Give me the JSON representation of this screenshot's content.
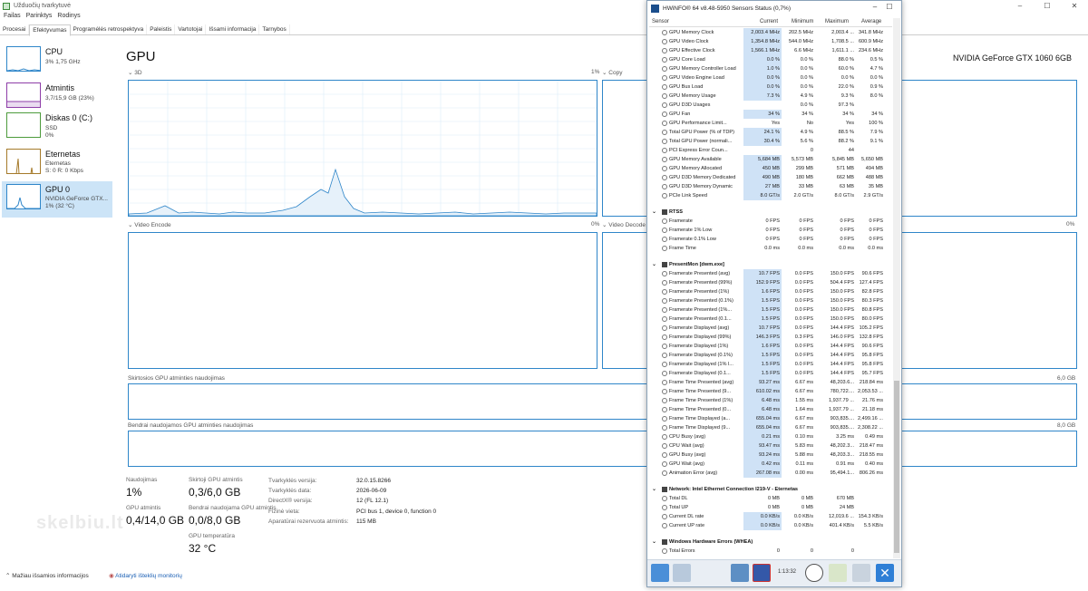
{
  "taskmanager": {
    "title": "Užduočių tvarkytuvė",
    "menu": [
      "Failas",
      "Parinktys",
      "Rodinys"
    ],
    "tabs": [
      "Procesai",
      "Efektyvumas",
      "Programėlės retrospektyva",
      "Paleistis",
      "Vartotojai",
      "Išsami informacija",
      "Tarnybos"
    ],
    "active_tab": 1,
    "sidebar": [
      {
        "name": "CPU",
        "sub1": "3%  1,75 GHz",
        "sub2": "",
        "sub3": ""
      },
      {
        "name": "Atmintis",
        "sub1": "3,7/15,9 GB (23%)",
        "sub2": "",
        "sub3": ""
      },
      {
        "name": "Diskas 0 (C:)",
        "sub1": "SSD",
        "sub2": "0%",
        "sub3": ""
      },
      {
        "name": "Eternetas",
        "sub1": "Eternetas",
        "sub2": "S: 0 R: 0 Kbps",
        "sub3": ""
      },
      {
        "name": "GPU 0",
        "sub1": "NVIDIA GeForce GTX...",
        "sub2": "1% (32 °C)",
        "sub3": ""
      }
    ],
    "heading": "GPU",
    "gpu_name": "NVIDIA GeForce GTX 1060 6GB",
    "graphs": {
      "g3d": "3D",
      "g3d_pct": "1%",
      "copy": "Copy",
      "venc": "Video Encode",
      "venc_pct": "0%",
      "vdec": "Video Decode",
      "vdec_pct": "0%",
      "dedicated": "Skirtosios GPU atminties naudojimas",
      "dedicated_max": "6,0 GB",
      "shared": "Bendrai naudojamos GPU atminties naudojimas",
      "shared_max": "8,0 GB"
    },
    "stats": {
      "usage_label": "Naudojimas",
      "usage_value": "1%",
      "dedicated_label": "Skirtoji GPU atmintis",
      "dedicated_value": "0,3/6,0 GB",
      "gpumem_label": "GPU atmintis",
      "gpumem_value": "0,4/14,0 GB",
      "shared_label": "Bendrai naudojama GPU atmintis",
      "shared_value": "0,0/8,0 GB",
      "temp_label": "GPU temperatūra",
      "temp_value": "32 °C"
    },
    "info": [
      {
        "label": "Tvarkyklės versija:",
        "value": "32.0.15.8266"
      },
      {
        "label": "Tvarkyklės data:",
        "value": "2026-06-09"
      },
      {
        "label": "DirectX® versija:",
        "value": "12 (FL 12.1)"
      },
      {
        "label": "Fizinė vieta:",
        "value": "PCI bus 1, device 0, function 0"
      },
      {
        "label": "Aparatūrai rezervuota atmintis:",
        "value": "115 MB"
      }
    ],
    "footer": {
      "fewer": "Mažiau išsamios informacijos",
      "monitor": "Atidaryti išteklių monitorių"
    },
    "watermark": "skelbiu.lt"
  },
  "hwinfo": {
    "title": "HWiNFO® 64 v8.48-5950 Sensors Status (0,7%)",
    "columns": [
      "Sensor",
      "Current",
      "Minimum",
      "Maximum",
      "Average"
    ],
    "rows": [
      {
        "type": "row",
        "name": "GPU Memory Clock",
        "v": [
          "2,003.4 MHz",
          "202.5 MHz",
          "2,003.4 ...",
          "341.8 MHz"
        ],
        "hl": true
      },
      {
        "type": "row",
        "name": "GPU Video Clock",
        "v": [
          "1,354.8 MHz",
          "544.0 MHz",
          "1,708.5 ...",
          "600.9 MHz"
        ],
        "hl": true
      },
      {
        "type": "row",
        "name": "GPU Effective Clock",
        "v": [
          "1,566.1 MHz",
          "6.6 MHz",
          "1,611.1 ...",
          "234.6 MHz"
        ],
        "hl": true
      },
      {
        "type": "row",
        "name": "GPU Core Load",
        "v": [
          "0.0 %",
          "0.0 %",
          "88.0 %",
          "0.5 %"
        ],
        "hl": true
      },
      {
        "type": "row",
        "name": "GPU Memory Controller Load",
        "v": [
          "1.0 %",
          "0.0 %",
          "60.0 %",
          "4.7 %"
        ],
        "hl": true
      },
      {
        "type": "row",
        "name": "GPU Video Engine Load",
        "v": [
          "0.0 %",
          "0.0 %",
          "0.0 %",
          "0.0 %"
        ],
        "hl": true
      },
      {
        "type": "row",
        "name": "GPU Bus Load",
        "v": [
          "0.0 %",
          "0.0 %",
          "22.0 %",
          "0.9 %"
        ],
        "hl": true
      },
      {
        "type": "row",
        "name": "GPU Memory Usage",
        "v": [
          "7.3 %",
          "4.9 %",
          "9.3 %",
          "8.0 %"
        ],
        "hl": true
      },
      {
        "type": "row",
        "name": "GPU D3D Usages",
        "v": [
          "",
          "0.0 %",
          "97.3 %",
          ""
        ],
        "hl": false
      },
      {
        "type": "row",
        "name": "GPU Fan",
        "v": [
          "34 %",
          "34 %",
          "34 %",
          "34 %"
        ],
        "hl": true
      },
      {
        "type": "row",
        "name": "GPU Performance Limit...",
        "v": [
          "Yes",
          "No",
          "Yes",
          "100 %"
        ],
        "hl": false
      },
      {
        "type": "row",
        "name": "Total GPU Power (% of TDP)",
        "v": [
          "24.1 %",
          "4.9 %",
          "88.5 %",
          "7.9 %"
        ],
        "hl": true
      },
      {
        "type": "row",
        "name": "Total GPU Power (normali...",
        "v": [
          "30.4 %",
          "5.6 %",
          "88.2 %",
          "9.1 %"
        ],
        "hl": true
      },
      {
        "type": "row",
        "name": "PCI Express Error Coun...",
        "v": [
          "",
          "0",
          "44",
          ""
        ],
        "hl": false
      },
      {
        "type": "row",
        "name": "GPU Memory Available",
        "v": [
          "5,684 MB",
          "5,573 MB",
          "5,845 MB",
          "5,650 MB"
        ],
        "hl": true
      },
      {
        "type": "row",
        "name": "GPU Memory Allocated",
        "v": [
          "450 MB",
          "299 MB",
          "571 MB",
          "494 MB"
        ],
        "hl": true
      },
      {
        "type": "row",
        "name": "GPU D3D Memory Dedicated",
        "v": [
          "490 MB",
          "180 MB",
          "662 MB",
          "488 MB"
        ],
        "hl": true
      },
      {
        "type": "row",
        "name": "GPU D3D Memory Dynamic",
        "v": [
          "27 MB",
          "33 MB",
          "63 MB",
          "35 MB"
        ],
        "hl": true
      },
      {
        "type": "row",
        "name": "PCIe Link Speed",
        "v": [
          "8.0 GT/s",
          "2.0 GT/s",
          "8.0 GT/s",
          "2.9 GT/s"
        ],
        "hl": true
      },
      {
        "type": "gap"
      },
      {
        "type": "group",
        "name": "RTSS"
      },
      {
        "type": "row",
        "name": "Framerate",
        "v": [
          "0 FPS",
          "0 FPS",
          "0 FPS",
          "0 FPS"
        ],
        "hl": false
      },
      {
        "type": "row",
        "name": "Framerate 1% Low",
        "v": [
          "0 FPS",
          "0 FPS",
          "0 FPS",
          "0 FPS"
        ],
        "hl": false
      },
      {
        "type": "row",
        "name": "Framerate 0.1% Low",
        "v": [
          "0 FPS",
          "0 FPS",
          "0 FPS",
          "0 FPS"
        ],
        "hl": false
      },
      {
        "type": "row",
        "name": "Frame Time",
        "v": [
          "0.0 ms",
          "0.0 ms",
          "0.0 ms",
          "0.0 ms"
        ],
        "hl": false
      },
      {
        "type": "gap"
      },
      {
        "type": "group",
        "name": "PresentMon [dwm.exe]"
      },
      {
        "type": "row",
        "name": "Framerate Presented (avg)",
        "v": [
          "10.7 FPS",
          "0.0 FPS",
          "150.0 FPS",
          "90.6 FPS"
        ],
        "hl": true
      },
      {
        "type": "row",
        "name": "Framerate Presented (99%)",
        "v": [
          "152.9 FPS",
          "0.0 FPS",
          "504.4 FPS",
          "127.4 FPS"
        ],
        "hl": true
      },
      {
        "type": "row",
        "name": "Framerate Presented (1%)",
        "v": [
          "1.6 FPS",
          "0.0 FPS",
          "150.0 FPS",
          "82.8 FPS"
        ],
        "hl": true
      },
      {
        "type": "row",
        "name": "Framerate Presented (0.1%)",
        "v": [
          "1.5 FPS",
          "0.0 FPS",
          "150.0 FPS",
          "80.3 FPS"
        ],
        "hl": true
      },
      {
        "type": "row",
        "name": "Framerate Presented (1%...",
        "v": [
          "1.5 FPS",
          "0.0 FPS",
          "150.0 FPS",
          "80.8 FPS"
        ],
        "hl": true
      },
      {
        "type": "row",
        "name": "Framerate Presented (0.1...",
        "v": [
          "1.5 FPS",
          "0.0 FPS",
          "150.0 FPS",
          "80.0 FPS"
        ],
        "hl": true
      },
      {
        "type": "row",
        "name": "Framerate Displayed (avg)",
        "v": [
          "10.7 FPS",
          "0.0 FPS",
          "144.4 FPS",
          "105.2 FPS"
        ],
        "hl": true
      },
      {
        "type": "row",
        "name": "Framerate Displayed (99%)",
        "v": [
          "146.3 FPS",
          "0.3 FPS",
          "146.0 FPS",
          "132.8 FPS"
        ],
        "hl": true
      },
      {
        "type": "row",
        "name": "Framerate Displayed (1%)",
        "v": [
          "1.6 FPS",
          "0.0 FPS",
          "144.4 FPS",
          "90.6 FPS"
        ],
        "hl": true
      },
      {
        "type": "row",
        "name": "Framerate Displayed (0.1%)",
        "v": [
          "1.5 FPS",
          "0.0 FPS",
          "144.4 FPS",
          "95.8 FPS"
        ],
        "hl": true
      },
      {
        "type": "row",
        "name": "Framerate Displayed (1% l...",
        "v": [
          "1.5 FPS",
          "0.0 FPS",
          "144.4 FPS",
          "95.8 FPS"
        ],
        "hl": true
      },
      {
        "type": "row",
        "name": "Framerate Displayed (0.1...",
        "v": [
          "1.5 FPS",
          "0.0 FPS",
          "144.4 FPS",
          "95.7 FPS"
        ],
        "hl": true
      },
      {
        "type": "row",
        "name": "Frame Time Presented (avg)",
        "v": [
          "93.27 ms",
          "6.67 ms",
          "48,203.6...",
          "218.84 ms"
        ],
        "hl": true
      },
      {
        "type": "row",
        "name": "Frame Time Presented (9...",
        "v": [
          "610.02 ms",
          "6.67 ms",
          "780,722....",
          "2,053.53 ..."
        ],
        "hl": true
      },
      {
        "type": "row",
        "name": "Frame Time Presented (1%)",
        "v": [
          "6.48 ms",
          "1.55 ms",
          "1,937.79 ...",
          "21.76 ms"
        ],
        "hl": true
      },
      {
        "type": "row",
        "name": "Frame Time Presented (0...",
        "v": [
          "6.48 ms",
          "1.64 ms",
          "1,937.79 ...",
          "21.18 ms"
        ],
        "hl": true
      },
      {
        "type": "row",
        "name": "Frame Time Displayed (a...",
        "v": [
          "655.04 ms",
          "6.67 ms",
          "903,835....",
          "2,499.16 ..."
        ],
        "hl": true
      },
      {
        "type": "row",
        "name": "Frame Time Displayed (9...",
        "v": [
          "655.04 ms",
          "6.67 ms",
          "903,835....",
          "2,308.22 ..."
        ],
        "hl": true
      },
      {
        "type": "row",
        "name": "CPU Busy (avg)",
        "v": [
          "0.21 ms",
          "0.10 ms",
          "3.25 ms",
          "0.49 ms"
        ],
        "hl": true
      },
      {
        "type": "row",
        "name": "CPU Wait (avg)",
        "v": [
          "93.47 ms",
          "5.83 ms",
          "48,202.3...",
          "218.47 ms"
        ],
        "hl": true
      },
      {
        "type": "row",
        "name": "GPU Busy (avg)",
        "v": [
          "93.24 ms",
          "5.88 ms",
          "48,203.3...",
          "218.55 ms"
        ],
        "hl": true
      },
      {
        "type": "row",
        "name": "GPU Wait (avg)",
        "v": [
          "0.42 ms",
          "0.11 ms",
          "0.91 ms",
          "0.40 ms"
        ],
        "hl": true
      },
      {
        "type": "row",
        "name": "Animation Error (avg)",
        "v": [
          "267.08 ms",
          "0.00 ms",
          "95,494.1...",
          "806.26 ms"
        ],
        "hl": true
      },
      {
        "type": "gap"
      },
      {
        "type": "group",
        "name": "Network: Intel Ethernet Connection I219-V - Eternetas"
      },
      {
        "type": "row",
        "name": "Total DL",
        "v": [
          "0 MB",
          "0 MB",
          "670 MB",
          ""
        ],
        "hl": false
      },
      {
        "type": "row",
        "name": "Total UP",
        "v": [
          "0 MB",
          "0 MB",
          "24 MB",
          ""
        ],
        "hl": false
      },
      {
        "type": "row",
        "name": "Current DL rate",
        "v": [
          "0.0 KB/s",
          "0.0 KB/s",
          "12,019.6 ...",
          "154.3 KB/s"
        ],
        "hl": true
      },
      {
        "type": "row",
        "name": "Current UP rate",
        "v": [
          "0.0 KB/s",
          "0.0 KB/s",
          "401.4 KB/s",
          "5.5 KB/s"
        ],
        "hl": true
      },
      {
        "type": "gap"
      },
      {
        "type": "group",
        "name": "Windows Hardware Errors (WHEA)"
      },
      {
        "type": "row",
        "name": "Total Errors",
        "v": [
          "0",
          "0",
          "0",
          ""
        ],
        "hl": false
      }
    ],
    "clock": "1:13:32"
  }
}
